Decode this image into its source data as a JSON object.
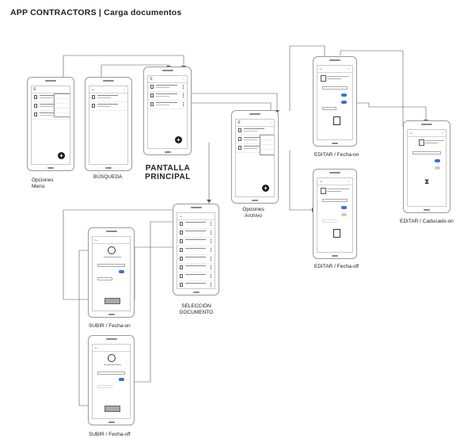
{
  "header": {
    "title": "APP CONTRACTORS | Carga documentos"
  },
  "screens": {
    "opciones_menu": {
      "label": "Opciones\nMenú"
    },
    "busqueda": {
      "label": "BÚSQUEDA"
    },
    "pantalla_principal": {
      "label": "PANTALLA\nPRINCIPAL"
    },
    "opciones_archivo": {
      "label": "Opciones\nArchivo"
    },
    "seleccion_documento": {
      "label": "SELECCIÓN\nDOCUMENTO"
    },
    "editar_fecha_on": {
      "label": "EDITAR / Fecha-on"
    },
    "editar_fecha_off": {
      "label": "EDITAR / Fecha-off"
    },
    "editar_caducado_on": {
      "label": "EDITAR / Caducado-on"
    },
    "subir_fecha_on": {
      "label": "SUBIR / Fecha-on"
    },
    "subir_fecha_off": {
      "label": "SUBIR / Fecha-off"
    }
  }
}
